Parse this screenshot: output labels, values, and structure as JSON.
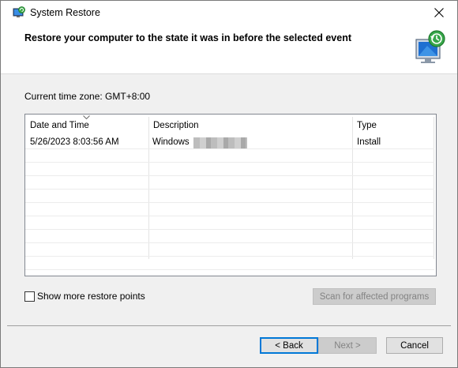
{
  "window": {
    "title": "System Restore"
  },
  "header": {
    "text": "Restore your computer to the state it was in before the selected event"
  },
  "timezone": {
    "text": "Current time zone: GMT+8:00"
  },
  "table": {
    "columns": [
      "Date and Time",
      "Description",
      "Type"
    ],
    "rows": [
      {
        "date": "5/26/2023 8:03:56 AM",
        "description": "Windows",
        "type": "Install"
      }
    ]
  },
  "options": {
    "show_more_label": "Show more restore points"
  },
  "buttons": {
    "scan": "Scan for affected programs",
    "back": "< Back",
    "next": "Next >",
    "cancel": "Cancel"
  },
  "icons": {
    "title": "system-restore-icon",
    "header": "system-restore-monitor-icon",
    "close": "close-icon"
  },
  "colors": {
    "accent": "#0078d7",
    "disabled_text": "#838383"
  }
}
